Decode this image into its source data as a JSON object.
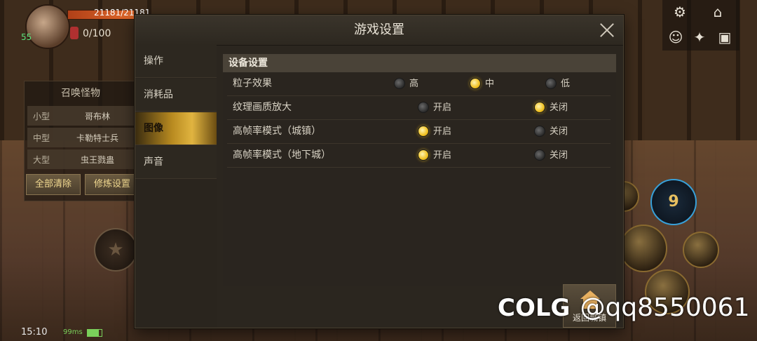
{
  "hud": {
    "hp": "21181/21181",
    "mp": "0/100",
    "level": "55"
  },
  "summon": {
    "title": "召唤怪物",
    "rows": [
      {
        "size": "小型",
        "name": "哥布林"
      },
      {
        "size": "中型",
        "name": "卡勒特士兵"
      },
      {
        "size": "大型",
        "name": "虫王戮蛊"
      }
    ],
    "clear_label": "全部清除",
    "train_label": "修炼设置"
  },
  "status": {
    "time": "15:10",
    "ping": "99ms"
  },
  "skill9": "9",
  "dialog": {
    "title": "游戏设置",
    "tabs": [
      "操作",
      "消耗品",
      "图像",
      "声音"
    ],
    "active_tab": "图像",
    "section": "设备设置",
    "settings": [
      {
        "label": "粒子效果",
        "options": [
          {
            "label": "高",
            "selected": false
          },
          {
            "label": "中",
            "selected": true
          },
          {
            "label": "低",
            "selected": false
          }
        ]
      },
      {
        "label": "纹理画质放大",
        "options": [
          {
            "label": "开启",
            "selected": false
          },
          {
            "label": "关闭",
            "selected": true
          }
        ]
      },
      {
        "label": "高帧率模式（城镇）",
        "options": [
          {
            "label": "开启",
            "selected": true
          },
          {
            "label": "关闭",
            "selected": false
          }
        ]
      },
      {
        "label": "高帧率模式（地下城）",
        "options": [
          {
            "label": "开启",
            "selected": true
          },
          {
            "label": "关闭",
            "selected": false
          }
        ]
      }
    ],
    "home_label": "返回城镇"
  },
  "watermark": {
    "logo": "COLG",
    "handle": "@qq8550061"
  },
  "colors": {
    "accent_gold": "#e0b440",
    "radio_on": "#f0c020",
    "panel_bg": "#2b261f"
  }
}
